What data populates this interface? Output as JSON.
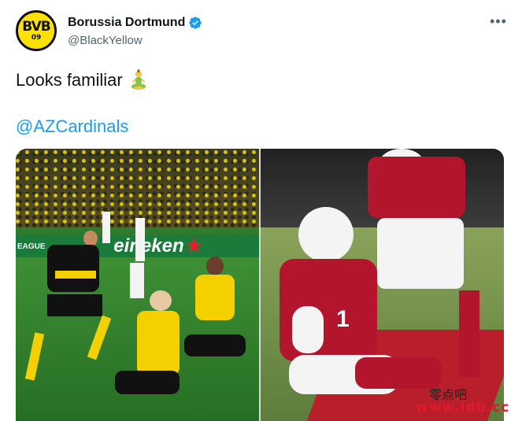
{
  "account": {
    "display_name": "Borussia Dortmund",
    "handle": "@BlackYellow",
    "verified": true,
    "avatar_text": "BVB",
    "avatar_year": "09"
  },
  "tweet": {
    "text": "Looks familiar",
    "emoji_icon": "person-meditating-icon",
    "mention": "@AZCardinals"
  },
  "media": {
    "left_photo": {
      "adboard_league": "EAGUE",
      "adboard_brand": "eineken"
    },
    "right_photo": {
      "jersey_number": "1"
    }
  },
  "menu": {
    "more_label": "•••"
  },
  "watermark": {
    "cjk": "零点吧",
    "latin": "www.ldb.cc"
  },
  "colors": {
    "verified": "#1d9bf0",
    "mention": "#1d9bf0",
    "bvb_yellow": "#fde100",
    "cardinals_red": "#b3162c"
  }
}
